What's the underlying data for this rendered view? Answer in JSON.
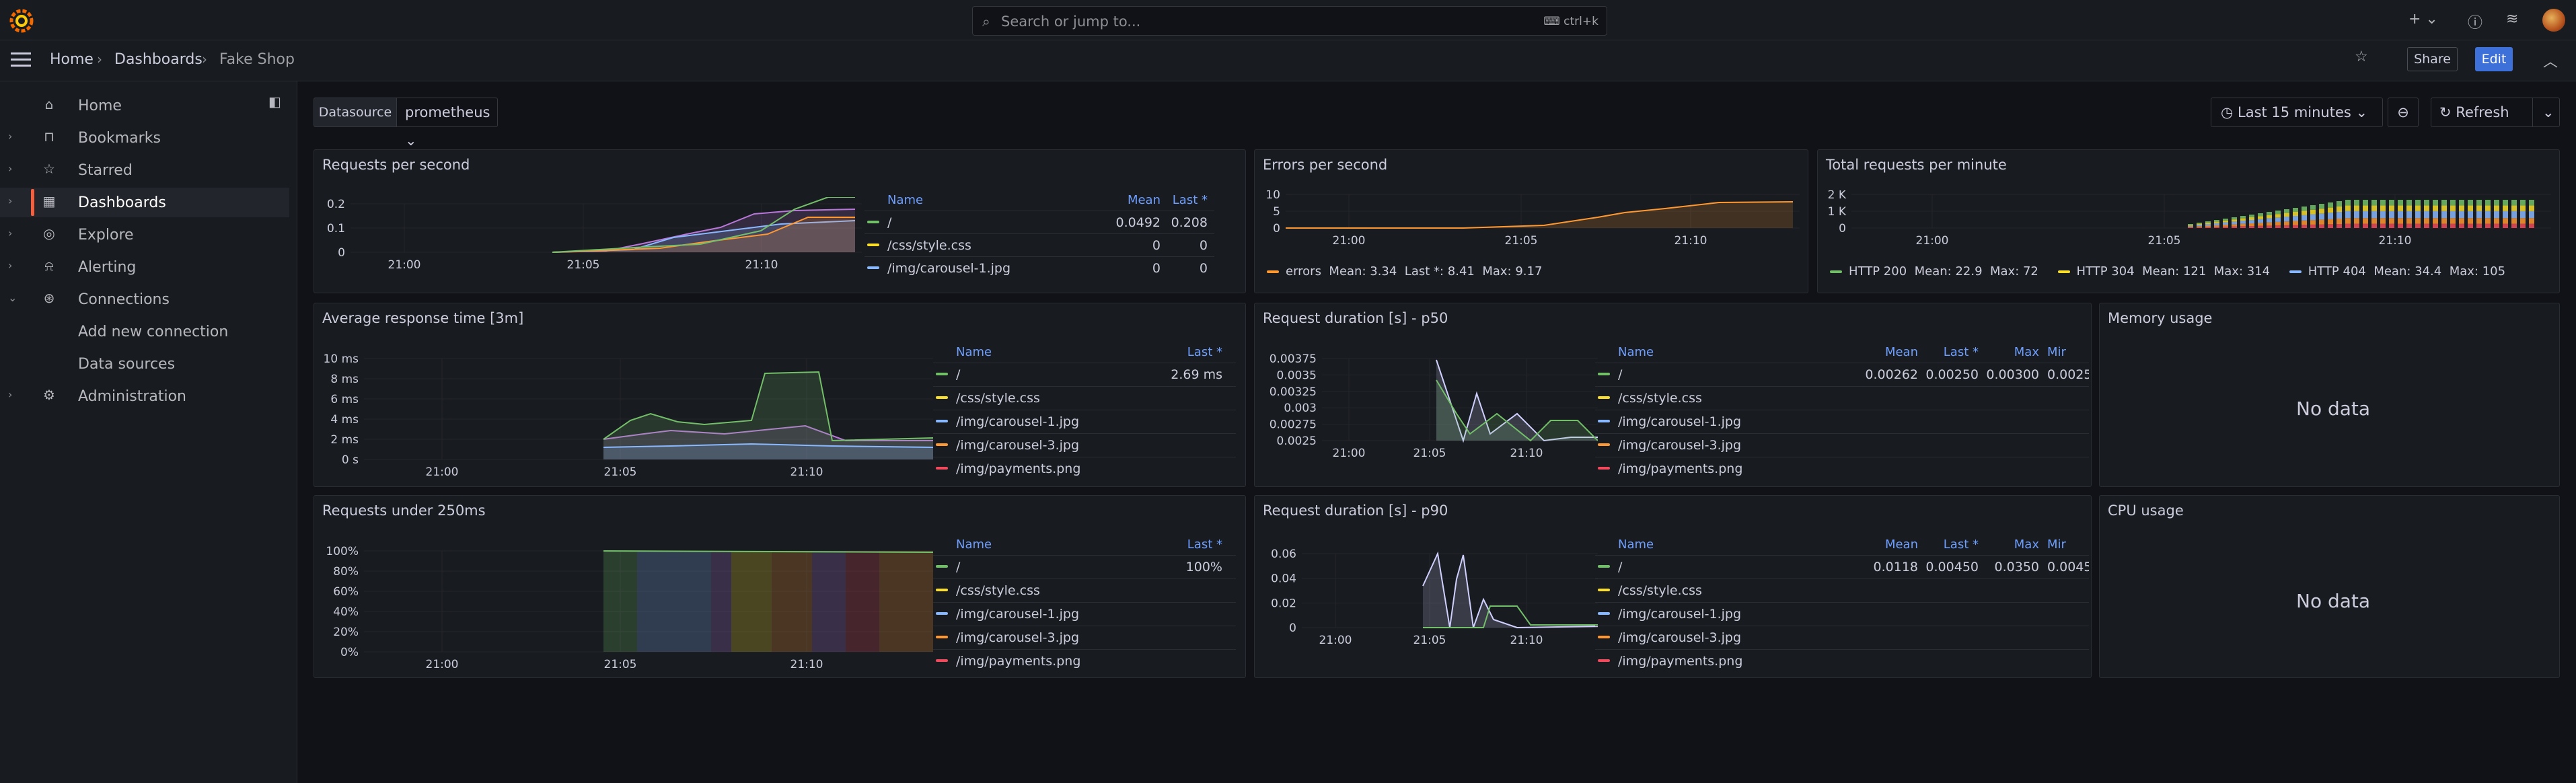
{
  "topbar": {
    "search_placeholder": "Search or jump to...",
    "search_shortcut": "ctrl+k"
  },
  "breadcrumb": {
    "home": "Home",
    "dashboards": "Dashboards",
    "current": "Fake Shop"
  },
  "actions": {
    "share": "Share",
    "edit": "Edit"
  },
  "sidebar": {
    "items": [
      {
        "label": "Home",
        "icon": "home-icon"
      },
      {
        "label": "Bookmarks",
        "icon": "bookmark-icon"
      },
      {
        "label": "Starred",
        "icon": "star-icon"
      },
      {
        "label": "Dashboards",
        "icon": "apps-icon"
      },
      {
        "label": "Explore",
        "icon": "compass-icon"
      },
      {
        "label": "Alerting",
        "icon": "bell-icon"
      },
      {
        "label": "Connections",
        "icon": "plug-icon"
      },
      {
        "label": "Add new connection"
      },
      {
        "label": "Data sources"
      },
      {
        "label": "Administration",
        "icon": "cog-icon"
      }
    ]
  },
  "variables": {
    "datasource_label": "Datasource",
    "datasource_value": "prometheus"
  },
  "timepicker": {
    "range": "Last 15 minutes",
    "refresh": "Refresh"
  },
  "colors": {
    "green": "#73bf69",
    "yellow": "#fade2a",
    "blue": "#8ab8ff",
    "orange": "#ff9830",
    "red": "#f2495c",
    "accent": "#3d71d9"
  },
  "panels": {
    "rps": {
      "title": "Requests per second",
      "y_ticks": [
        "0.2",
        "0.1",
        "0"
      ],
      "x_ticks": [
        "21:00",
        "21:05",
        "21:10"
      ],
      "legend_headers": {
        "name": "Name",
        "mean": "Mean",
        "last": "Last *"
      },
      "rows": [
        {
          "name": "/",
          "mean": "0.0492",
          "last": "0.208",
          "color": "#73bf69"
        },
        {
          "name": "/css/style.css",
          "mean": "0",
          "last": "0",
          "color": "#fade2a"
        },
        {
          "name": "/img/carousel-1.jpg",
          "mean": "0",
          "last": "0",
          "color": "#8ab8ff"
        }
      ]
    },
    "eps": {
      "title": "Errors per second",
      "y_ticks": [
        "10",
        "5",
        "0"
      ],
      "x_ticks": [
        "21:00",
        "21:05",
        "21:10"
      ],
      "legend": {
        "name": "errors",
        "mean": "Mean: 3.34",
        "last": "Last *: 8.41",
        "max": "Max: 9.17",
        "color": "#ff9830"
      }
    },
    "trpm": {
      "title": "Total requests per minute",
      "y_ticks": [
        "2 K",
        "1 K",
        "0"
      ],
      "x_ticks": [
        "21:00",
        "21:05",
        "21:10"
      ],
      "legend": [
        {
          "name": "HTTP 200",
          "mean": "Mean: 22.9",
          "max": "Max: 72",
          "color": "#73bf69"
        },
        {
          "name": "HTTP 304",
          "mean": "Mean: 121",
          "max": "Max: 314",
          "color": "#fade2a"
        },
        {
          "name": "HTTP 404",
          "mean": "Mean: 34.4",
          "max": "Max: 105",
          "color": "#8ab8ff"
        }
      ]
    },
    "art": {
      "title": "Average response time [3m]",
      "y_ticks": [
        "10 ms",
        "8 ms",
        "6 ms",
        "4 ms",
        "2 ms",
        "0 s"
      ],
      "x_ticks": [
        "21:00",
        "21:05",
        "21:10"
      ],
      "legend_headers": {
        "name": "Name",
        "last": "Last *"
      },
      "rows": [
        {
          "name": "/",
          "last": "2.69 ms",
          "color": "#73bf69"
        },
        {
          "name": "/css/style.css",
          "last": "",
          "color": "#fade2a"
        },
        {
          "name": "/img/carousel-1.jpg",
          "last": "",
          "color": "#8ab8ff"
        },
        {
          "name": "/img/carousel-3.jpg",
          "last": "",
          "color": "#ff9830"
        },
        {
          "name": "/img/payments.png",
          "last": "",
          "color": "#f2495c"
        }
      ]
    },
    "p50": {
      "title": "Request duration [s] - p50",
      "y_ticks": [
        "0.00375",
        "0.0035",
        "0.00325",
        "0.003",
        "0.00275",
        "0.0025"
      ],
      "x_ticks": [
        "21:00",
        "21:05",
        "21:10"
      ],
      "legend_headers": {
        "name": "Name",
        "mean": "Mean",
        "last": "Last *",
        "max": "Max",
        "min": "Mir"
      },
      "rows": [
        {
          "name": "/",
          "mean": "0.00262",
          "last": "0.00250",
          "max": "0.00300",
          "min": "0.0025",
          "color": "#73bf69"
        },
        {
          "name": "/css/style.css",
          "color": "#fade2a"
        },
        {
          "name": "/img/carousel-1.jpg",
          "color": "#8ab8ff"
        },
        {
          "name": "/img/carousel-3.jpg",
          "color": "#ff9830"
        },
        {
          "name": "/img/payments.png",
          "color": "#f2495c"
        }
      ]
    },
    "mem": {
      "title": "Memory usage",
      "nodata": "No data"
    },
    "u250": {
      "title": "Requests under 250ms",
      "y_ticks": [
        "100%",
        "80%",
        "60%",
        "40%",
        "20%",
        "0%"
      ],
      "x_ticks": [
        "21:00",
        "21:05",
        "21:10"
      ],
      "legend_headers": {
        "name": "Name",
        "last": "Last *"
      },
      "rows": [
        {
          "name": "/",
          "last": "100%",
          "color": "#73bf69"
        },
        {
          "name": "/css/style.css",
          "last": "",
          "color": "#fade2a"
        },
        {
          "name": "/img/carousel-1.jpg",
          "last": "",
          "color": "#8ab8ff"
        },
        {
          "name": "/img/carousel-3.jpg",
          "last": "",
          "color": "#ff9830"
        },
        {
          "name": "/img/payments.png",
          "last": "",
          "color": "#f2495c"
        }
      ]
    },
    "p90": {
      "title": "Request duration [s] - p90",
      "y_ticks": [
        "0.06",
        "0.04",
        "0.02",
        "0"
      ],
      "x_ticks": [
        "21:00",
        "21:05",
        "21:10"
      ],
      "legend_headers": {
        "name": "Name",
        "mean": "Mean",
        "last": "Last *",
        "max": "Max",
        "min": "Mir"
      },
      "rows": [
        {
          "name": "/",
          "mean": "0.0118",
          "last": "0.00450",
          "max": "0.0350",
          "min": "0.0045",
          "color": "#73bf69"
        },
        {
          "name": "/css/style.css",
          "color": "#fade2a"
        },
        {
          "name": "/img/carousel-1.jpg",
          "color": "#8ab8ff"
        },
        {
          "name": "/img/carousel-3.jpg",
          "color": "#ff9830"
        },
        {
          "name": "/img/payments.png",
          "color": "#f2495c"
        }
      ]
    },
    "cpu": {
      "title": "CPU usage",
      "nodata": "No data"
    }
  }
}
